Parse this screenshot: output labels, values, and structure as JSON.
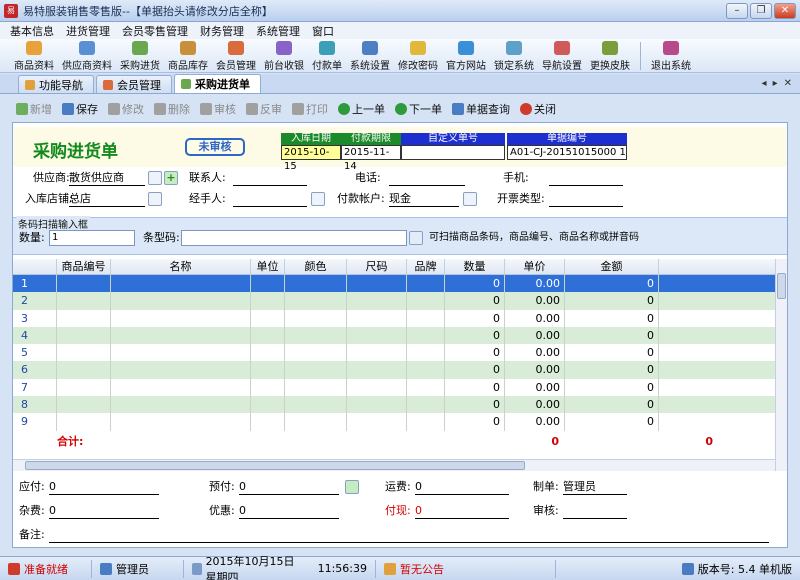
{
  "window": {
    "title": "易特服装销售零售版--【单据抬头请修改分店全称】",
    "app_icon_text": "易"
  },
  "menu": [
    "基本信息",
    "进货管理",
    "会员零售管理",
    "财务管理",
    "系统管理",
    "窗口"
  ],
  "toolbar": [
    {
      "label": "商品资料",
      "icon": "clothes-icon",
      "color": "#e8a23c"
    },
    {
      "label": "供应商资料",
      "icon": "people-icon",
      "color": "#5a8fd6"
    },
    {
      "label": "采购进货",
      "icon": "truck-icon",
      "color": "#6aa84f"
    },
    {
      "label": "商品库存",
      "icon": "box-icon",
      "color": "#c98f3a"
    },
    {
      "label": "会员管理",
      "icon": "member-icon",
      "color": "#d96b3c"
    },
    {
      "label": "前台收银",
      "icon": "cashier-icon",
      "color": "#8a63c9"
    },
    {
      "label": "付款单",
      "icon": "payment-icon",
      "color": "#3c9fb5"
    },
    {
      "label": "系统设置",
      "icon": "settings-icon",
      "color": "#4d7fc2"
    },
    {
      "label": "修改密码",
      "icon": "key-icon",
      "color": "#e0b83a"
    },
    {
      "label": "官方网站",
      "icon": "globe-icon",
      "color": "#3a8fd9"
    },
    {
      "label": "锁定系统",
      "icon": "lock-icon",
      "color": "#5fa0c8"
    },
    {
      "label": "导航设置",
      "icon": "nav-icon",
      "color": "#d05a5a"
    },
    {
      "label": "更换皮肤",
      "icon": "skin-icon",
      "color": "#7b9e3c"
    },
    {
      "label": "退出系统",
      "icon": "exit-icon",
      "color": "#b84a8c"
    }
  ],
  "tabs": [
    {
      "label": "功能导航",
      "active": false
    },
    {
      "label": "会员管理",
      "active": false
    },
    {
      "label": "采购进货单",
      "active": true
    }
  ],
  "doc_toolbar": [
    {
      "label": "新增",
      "icon": "add-icon",
      "disabled": true,
      "color": "#6cae5e"
    },
    {
      "label": "保存",
      "icon": "save-icon",
      "disabled": false,
      "color": "#4a7cc4"
    },
    {
      "label": "修改",
      "icon": "edit-icon",
      "disabled": true,
      "color": "#a0a0a0"
    },
    {
      "label": "删除",
      "icon": "delete-icon",
      "disabled": true,
      "color": "#a0a0a0"
    },
    {
      "label": "审核",
      "icon": "approve-icon",
      "disabled": true,
      "color": "#a0a0a0"
    },
    {
      "label": "反审",
      "icon": "unapprove-icon",
      "disabled": true,
      "color": "#a0a0a0"
    },
    {
      "label": "打印",
      "icon": "print-icon",
      "disabled": true,
      "color": "#a0a0a0"
    },
    {
      "label": "上一单",
      "icon": "prev-icon",
      "disabled": false,
      "color": "#2e9a3c"
    },
    {
      "label": "下一单",
      "icon": "next-icon",
      "disabled": false,
      "color": "#2e9a3c"
    },
    {
      "label": "单据查询",
      "icon": "search-icon",
      "disabled": false,
      "color": "#4a7cc4"
    },
    {
      "label": "关闭",
      "icon": "close-icon",
      "disabled": false,
      "color": "#d03a2a"
    }
  ],
  "header": {
    "doc_title": "采购进货单",
    "status": "未审核",
    "fields": [
      {
        "label": "入库日期",
        "value": "2015-10-15",
        "label_color": "#1a8a2a",
        "value_bg": "#ffff99"
      },
      {
        "label": "付款期限",
        "value": "2015-11-14",
        "label_color": "#1a8a2a",
        "value_bg": "#ffffff"
      },
      {
        "label": "自定义单号",
        "value": "",
        "label_color": "#1e2fd0",
        "value_bg": "#ffffff"
      },
      {
        "label": "单据编号",
        "value": "A01-CJ-20151015000 1",
        "label_color": "#1e2fd0",
        "value_bg": "#ffffff"
      }
    ]
  },
  "form": {
    "supplier_label": "供应商:",
    "supplier_value": "散货供应商",
    "contact_label": "联系人:",
    "contact_value": "",
    "phone_label": "电话:",
    "phone_value": "",
    "mobile_label": "手机:",
    "mobile_value": "",
    "store_label": "入库店铺:",
    "store_value": "总店",
    "handler_label": "经手人:",
    "handler_value": "",
    "account_label": "付款帐户:",
    "account_value": "现金",
    "invoice_label": "开票类型:",
    "invoice_value": ""
  },
  "scan": {
    "title": "条码扫描输入框",
    "qty_label": "数量:",
    "qty_value": "1",
    "barcode_label": "条型码:",
    "barcode_value": "",
    "hint": "可扫描商品条码，商品编号、商品名称或拼音码"
  },
  "grid": {
    "columns": [
      "",
      "商品编号",
      "名称",
      "单位",
      "颜色",
      "尺码",
      "品牌",
      "数量",
      "单价",
      "金额"
    ],
    "rows": [
      [
        "1",
        "",
        "",
        "",
        "",
        "",
        "",
        "0",
        "0.00",
        "0"
      ],
      [
        "2",
        "",
        "",
        "",
        "",
        "",
        "",
        "0",
        "0.00",
        "0"
      ],
      [
        "3",
        "",
        "",
        "",
        "",
        "",
        "",
        "0",
        "0.00",
        "0"
      ],
      [
        "4",
        "",
        "",
        "",
        "",
        "",
        "",
        "0",
        "0.00",
        "0"
      ],
      [
        "5",
        "",
        "",
        "",
        "",
        "",
        "",
        "0",
        "0.00",
        "0"
      ],
      [
        "6",
        "",
        "",
        "",
        "",
        "",
        "",
        "0",
        "0.00",
        "0"
      ],
      [
        "7",
        "",
        "",
        "",
        "",
        "",
        "",
        "0",
        "0.00",
        "0"
      ],
      [
        "8",
        "",
        "",
        "",
        "",
        "",
        "",
        "0",
        "0.00",
        "0"
      ],
      [
        "9",
        "",
        "",
        "",
        "",
        "",
        "",
        "0",
        "0.00",
        "0"
      ]
    ],
    "total_label": "合计:",
    "total_qty": "0",
    "total_amount": "0"
  },
  "footer": {
    "payable_label": "应付:",
    "payable_value": "0",
    "prepaid_label": "预付:",
    "prepaid_value": "0",
    "freight_label": "运费:",
    "freight_value": "0",
    "creator_label": "制单:",
    "creator_value": "管理员",
    "misc_label": "杂费:",
    "misc_value": "0",
    "discount_label": "优惠:",
    "discount_value": "0",
    "cash_label": "付现:",
    "cash_value": "0",
    "auditor_label": "审核:",
    "auditor_value": "",
    "remark_label": "备注:",
    "remark_value": ""
  },
  "statusbar": {
    "ready": "准备就绪",
    "user": "管理员",
    "date": "2015年10月15日 星期四",
    "time": "11:56:39",
    "notice": "暂无公告",
    "version": "版本号: 5.4 单机版"
  }
}
